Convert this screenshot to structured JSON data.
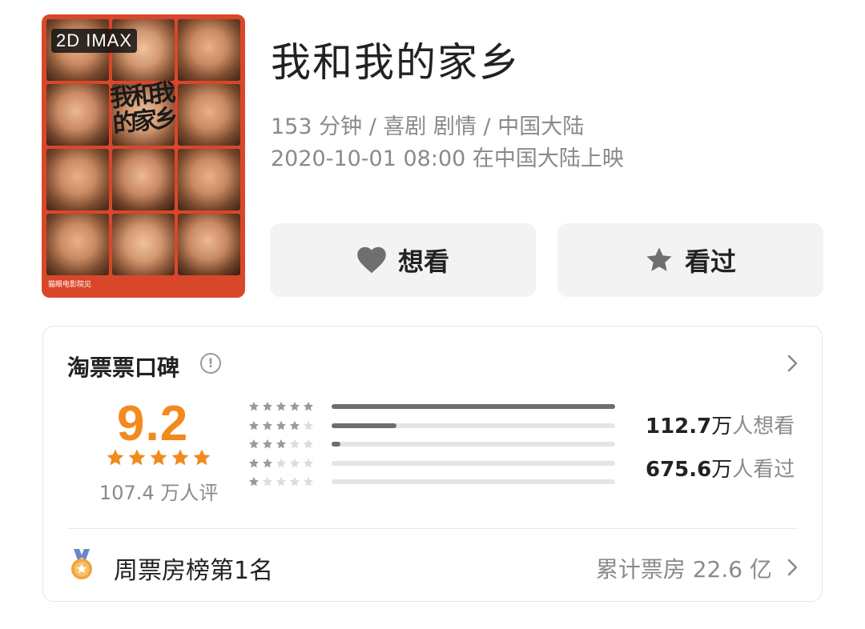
{
  "poster": {
    "badge": "2D IMAX",
    "title_art": "我和我的家乡",
    "footer": "猫眼电影院见"
  },
  "movie": {
    "title": "我和我的家乡",
    "meta_line_1": "153 分钟 / 喜剧 剧情 / 中国大陆",
    "meta_line_2": "2020-10-01 08:00 在中国大陆上映"
  },
  "actions": {
    "want_label": "想看",
    "seen_label": "看过",
    "want_icon": "heart-icon",
    "seen_icon": "star-icon"
  },
  "rating_card": {
    "title": "淘票票口碑",
    "score": "9.2",
    "score_stars": 5,
    "rating_count": "107.4 万人评",
    "distribution": [
      {
        "stars": 5,
        "fraction": 1.0
      },
      {
        "stars": 4,
        "fraction": 0.23
      },
      {
        "stars": 3,
        "fraction": 0.03
      },
      {
        "stars": 2,
        "fraction": 0.0
      },
      {
        "stars": 1,
        "fraction": 0.0
      }
    ],
    "want_count_num": "112.7",
    "want_count_unit": "万",
    "want_count_suffix": "人想看",
    "seen_count_num": "675.6",
    "seen_count_unit": "万",
    "seen_count_suffix": "人看过",
    "rank_text": "周票房榜第1名",
    "box_office": "累计票房 22.6 亿"
  },
  "colors": {
    "accent_orange": "#f28a1e",
    "poster_red": "#d9472b",
    "bar_fill": "#6e6e6e",
    "bar_track": "#e5e5e5",
    "muted_text": "#8a8a8a"
  }
}
